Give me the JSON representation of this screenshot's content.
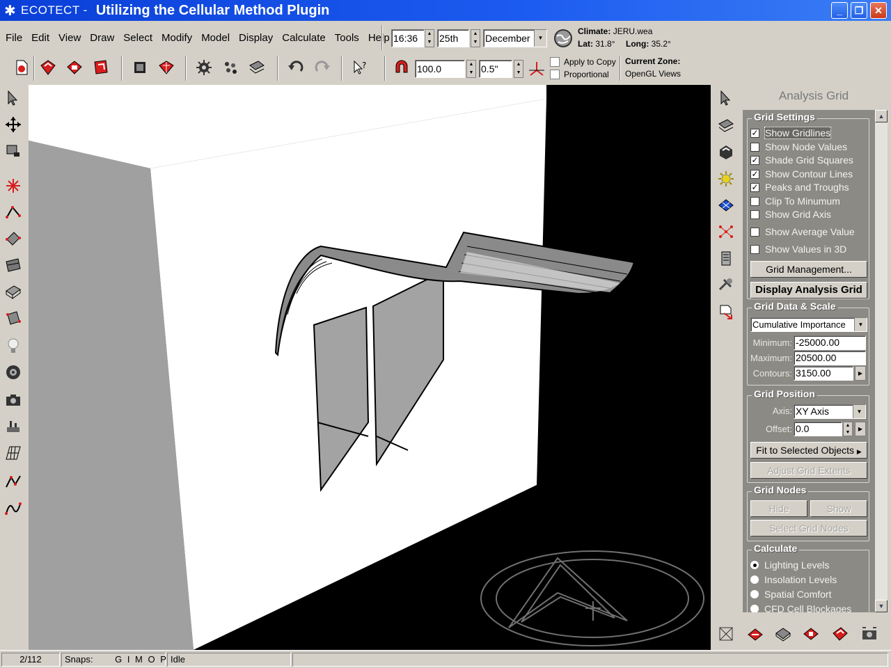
{
  "title_bar": {
    "app_name": "ECOTECT -",
    "document_title": "Utilizing the Cellular Method Plugin"
  },
  "menu": [
    "File",
    "Edit",
    "View",
    "Draw",
    "Select",
    "Modify",
    "Model",
    "Display",
    "Calculate",
    "Tools",
    "Help"
  ],
  "date_time": {
    "time": "16:36",
    "day": "25th",
    "month": "December"
  },
  "climate": {
    "label": "Climate:",
    "file": "JERU.wea",
    "lat_label": "Lat:",
    "lat": "31.8°",
    "long_label": "Long:",
    "long": "35.2°"
  },
  "toolbar2": {
    "value1": "100.0",
    "value2": "0.5\"",
    "apply_to_copy": "Apply to Copy",
    "proportional": "Proportional",
    "current_zone_label": "Current Zone:",
    "current_zone": "OpenGL Views"
  },
  "panel": {
    "title": "Analysis Grid",
    "grid_settings": {
      "label": "Grid Settings",
      "options": [
        {
          "label": "Show Gridlines",
          "checked": true
        },
        {
          "label": "Show Node Values",
          "checked": false
        },
        {
          "label": "Shade Grid Squares",
          "checked": true
        },
        {
          "label": "Show Contour Lines",
          "checked": true
        },
        {
          "label": "Peaks and Troughs",
          "checked": true
        },
        {
          "label": "Clip To Minumum",
          "checked": false
        },
        {
          "label": "Show Grid Axis",
          "checked": false
        },
        {
          "label": "Show Average Value",
          "checked": false
        },
        {
          "label": "Show Values in 3D",
          "checked": false
        }
      ],
      "grid_management": "Grid Management...",
      "display_analysis_grid": "Display Analysis Grid"
    },
    "grid_data": {
      "label": "Grid Data & Scale",
      "data_type": "Cumulative Importance",
      "minimum_label": "Minimum:",
      "minimum": "-25000.00",
      "maximum_label": "Maximum:",
      "maximum": "20500.00",
      "contours_label": "Contours:",
      "contours": "3150.00"
    },
    "grid_position": {
      "label": "Grid Position",
      "axis_label": "Axis:",
      "axis": "XY Axis",
      "offset_label": "Offset:",
      "offset": "0.0",
      "fit": "Fit to Selected Objects",
      "adjust": "Adjust Grid Extents"
    },
    "grid_nodes": {
      "label": "Grid Nodes",
      "hide": "Hide",
      "show": "Show",
      "select": "Select Grid Nodes"
    },
    "calculate": {
      "label": "Calculate",
      "options": [
        {
          "label": "Lighting Levels",
          "selected": true
        },
        {
          "label": "Insolation Levels",
          "selected": false
        },
        {
          "label": "Spatial Comfort",
          "selected": false
        },
        {
          "label": "CFD Cell Blockages",
          "selected": false
        }
      ]
    }
  },
  "status": {
    "count": "2/112",
    "snaps_label": "Snaps:",
    "snaps": "G I  M O P",
    "state": "Idle"
  },
  "colors": {
    "titlebar": "#1d5cf0",
    "panel_bg": "#8c8a84",
    "viewport_bg": "#000000",
    "face_light": "#ffffff",
    "face_dark": "#a0a0a0"
  }
}
